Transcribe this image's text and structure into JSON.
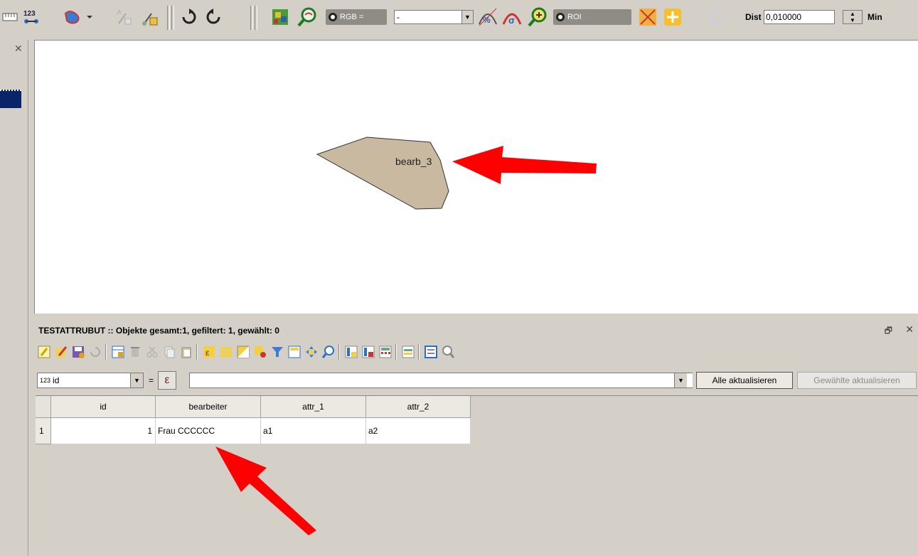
{
  "toolbar": {
    "rgb_label": "RGB =",
    "rgb_value": "-",
    "roi_label": "ROI",
    "dist_label": "Dist",
    "dist_value": "0,010000",
    "min_label": "Min",
    "badge_123": "123"
  },
  "map": {
    "feature_label": "bearb_3",
    "feature_fill": "#c8b9a0"
  },
  "attribute_panel": {
    "title": "TESTATTRUBUT :: Objekte gesamt:1, gefiltert: 1, gewählt: 0",
    "field_tag": "123",
    "field_value": "id",
    "equals": "=",
    "epsilon": "ε",
    "expression": "",
    "update_all": "Alle aktualisieren",
    "update_selected": "Gewählte aktualisieren"
  },
  "table": {
    "columns": [
      "id",
      "bearbeiter",
      "attr_1",
      "attr_2"
    ],
    "rows": [
      {
        "row_num": "1",
        "id": "1",
        "bearbeiter": "Frau CCCCCC",
        "attr_1": "a1",
        "attr_2": "a2"
      }
    ]
  },
  "annotations": {
    "arrow_color": "#ff0000"
  }
}
